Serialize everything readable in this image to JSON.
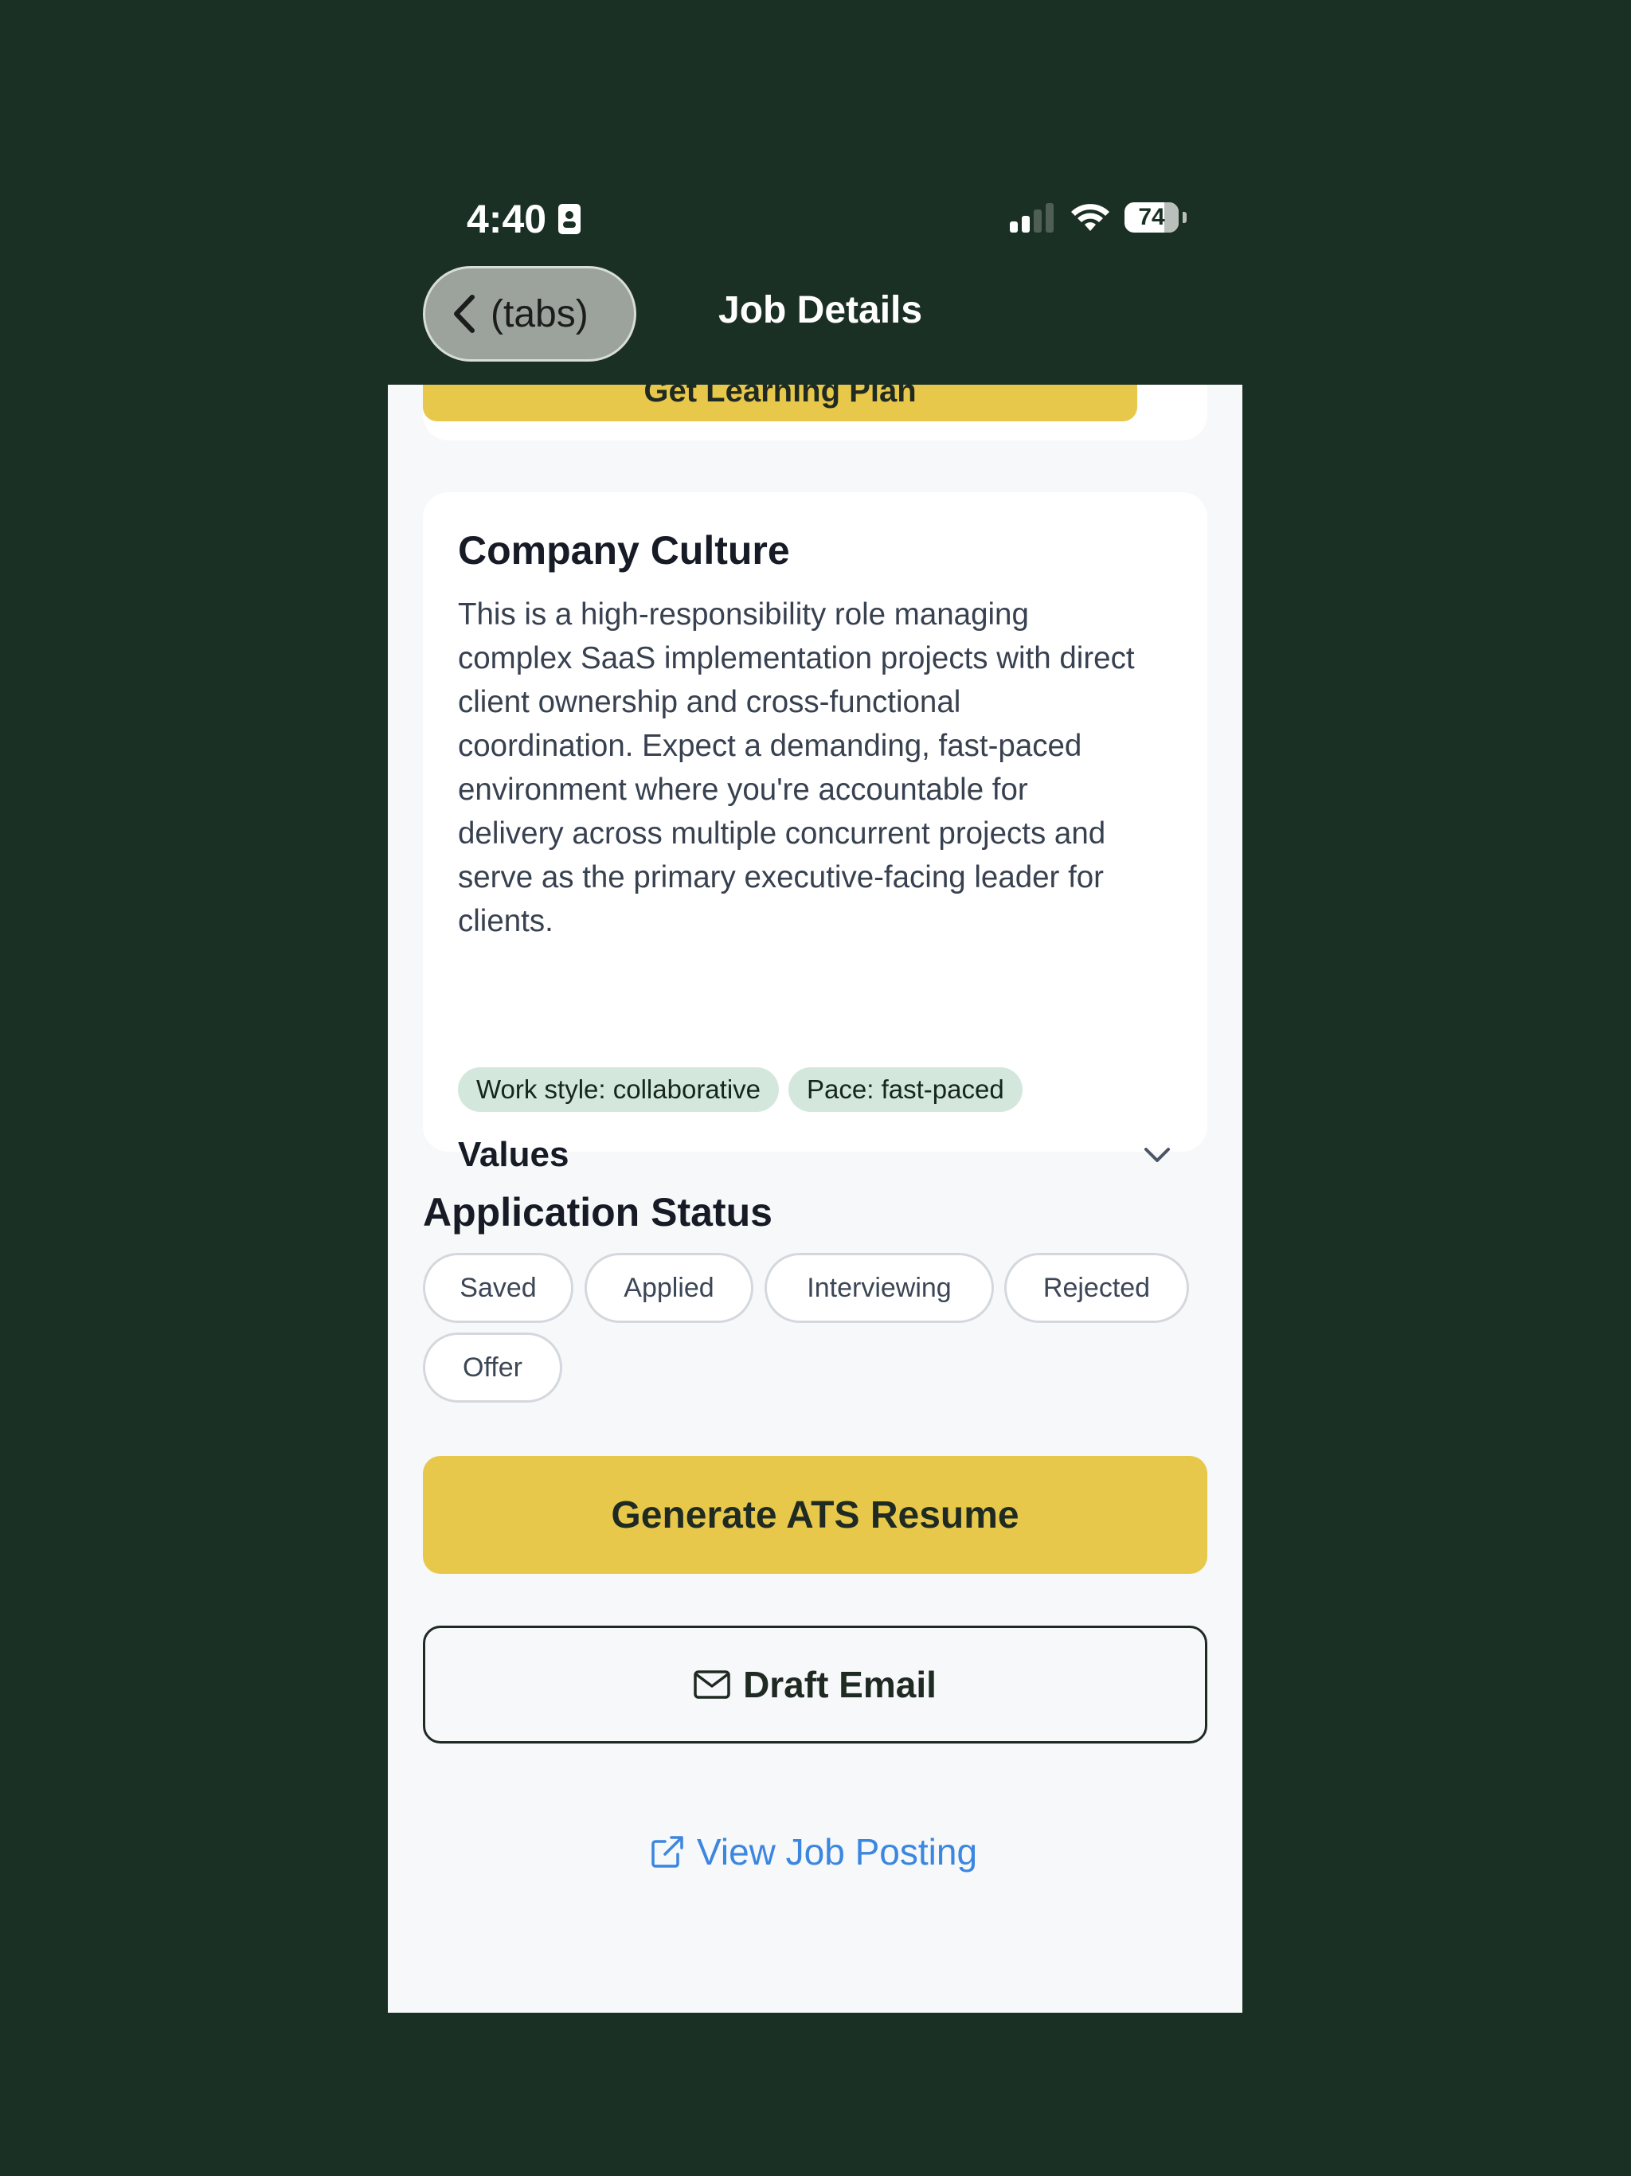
{
  "status_bar": {
    "time": "4:40",
    "battery": "74",
    "battery_level_percent": 74
  },
  "nav": {
    "back_label": "(tabs)",
    "title": "Job Details"
  },
  "learning": {
    "button_label": "Get Learning Plan"
  },
  "culture": {
    "title": "Company Culture",
    "lines": [
      "This is a high-responsibility role managing",
      "complex SaaS implementation projects with direct",
      "client ownership and cross-functional",
      "coordination. Expect a demanding, fast-paced",
      "environment where you're accountable for",
      "delivery across multiple concurrent projects and",
      "serve as the primary executive-facing leader for",
      "clients."
    ],
    "tags": [
      "Work style: collaborative",
      "Pace: fast-paced"
    ],
    "values_label": "Values"
  },
  "application": {
    "title": "Application Status",
    "statuses": [
      "Saved",
      "Applied",
      "Interviewing",
      "Rejected",
      "Offer"
    ]
  },
  "actions": {
    "generate_label": "Generate ATS Resume",
    "email_label": "Draft Email",
    "view_label": "View Job Posting"
  },
  "colors": {
    "background": "#1b3024",
    "accent_yellow": "#e7c84b",
    "link_blue": "#3b86e0",
    "chip_green": "#d3e7dc"
  },
  "icons": [
    "id-card-icon",
    "signal-icon",
    "wifi-icon",
    "battery-icon",
    "chevron-left-icon",
    "chevron-down-icon",
    "mail-icon",
    "external-link-icon"
  ]
}
